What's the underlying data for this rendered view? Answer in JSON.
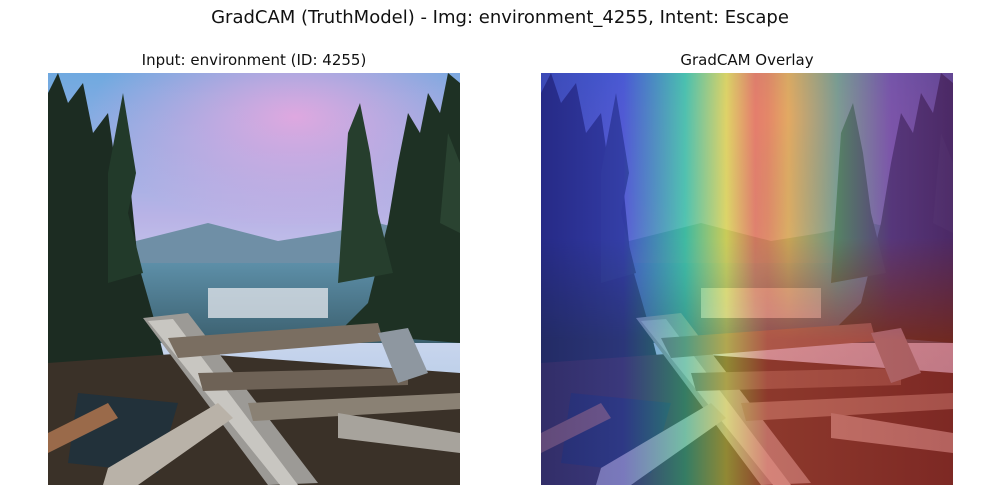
{
  "figure": {
    "suptitle": "GradCAM (TruthModel) - Img: environment_4255, Intent: Escape"
  },
  "panels": [
    {
      "title": "Input: environment (ID: 4255)",
      "content": "forest-lake-logs-photo"
    },
    {
      "title": "GradCAM Overlay",
      "content": "forest-lake-logs-photo-with-heatmap",
      "colormap": "jet",
      "colors": {
        "low": "#3030c8",
        "mid": "#30c8a0",
        "mid_high": "#e8e040",
        "high": "#e04030"
      }
    }
  ]
}
